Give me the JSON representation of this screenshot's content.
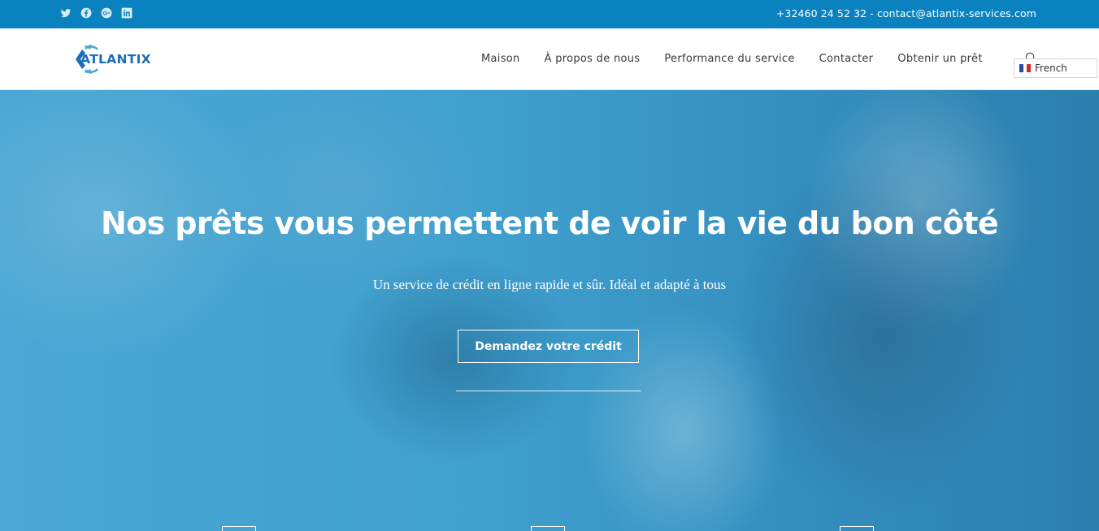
{
  "topbar": {
    "contact": "+32460 24 52 32 - contact@atlantix-services.com",
    "social": [
      "twitter-icon",
      "facebook-icon",
      "google-plus-icon",
      "linkedin-icon"
    ],
    "background": "#0a82bf"
  },
  "header": {
    "logo_text": "ATLANTIX",
    "nav": [
      "Maison",
      "À propos de nous",
      "Performance du service",
      "Contacter",
      "Obtenir un prêt"
    ],
    "language": "French"
  },
  "hero": {
    "title": "Nos prêts vous permettent de voir la vie du bon côté",
    "subtitle": "Un service de crédit en ligne rapide et sûr. Idéal et adapté à tous",
    "cta": "Demandez votre crédit"
  },
  "colors": {
    "brand": "#1d6fb8",
    "overlay": "#3d9ccb"
  }
}
